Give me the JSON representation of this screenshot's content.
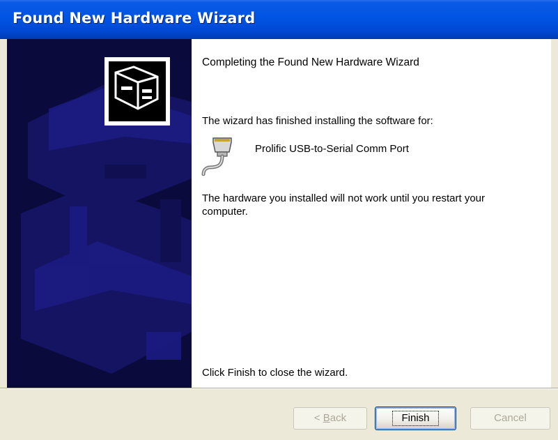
{
  "window": {
    "title": "Found New Hardware Wizard"
  },
  "main": {
    "heading": "Completing the Found New Hardware Wizard",
    "finished_text": "The wizard has finished installing the software for:",
    "device_name": "Prolific USB-to-Serial Comm Port",
    "device_icon": "serial-port-icon",
    "warning_text": "The hardware you installed will not work until you restart your computer.",
    "close_hint": "Click Finish to close the wizard."
  },
  "sidebar": {
    "icon": "hardware-wizard-icon"
  },
  "buttons": {
    "back_prefix": "< ",
    "back_mnemonic": "B",
    "back_rest": "ack",
    "finish": "Finish",
    "cancel": "Cancel"
  },
  "colors": {
    "titlebar": "#0054E3",
    "sidebar": "#0A0A3C",
    "dialog": "#ECE9D8"
  }
}
